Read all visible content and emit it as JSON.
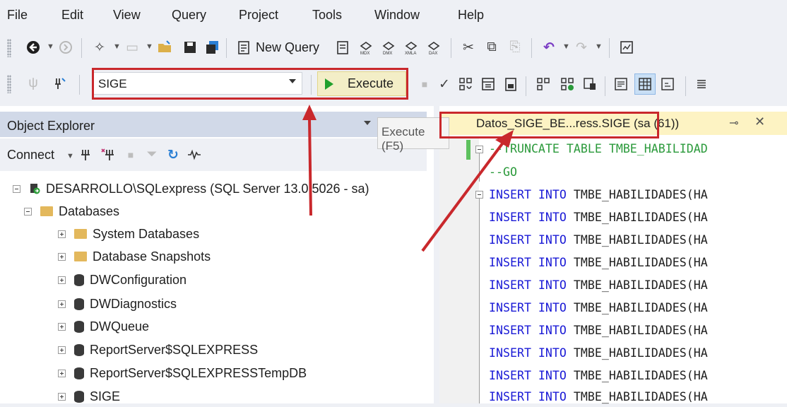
{
  "menu": [
    "File",
    "Edit",
    "View",
    "Query",
    "Project",
    "Tools",
    "Window",
    "Help"
  ],
  "toolbar1": {
    "new_query_label": "New Query"
  },
  "toolbar2": {
    "database": "SIGE",
    "execute_label": "Execute"
  },
  "tooltip": {
    "text": "Execute (F5)"
  },
  "object_explorer": {
    "title": "Object Explorer",
    "connect_label": "Connect",
    "tree": [
      {
        "label": "DESARROLLO\\SQLexpress (SQL Server 13.0.5026 - sa)",
        "icon": "server-icon"
      },
      {
        "label": "Databases",
        "icon": "folder-icon"
      },
      {
        "label": "System Databases",
        "icon": "folder-icon"
      },
      {
        "label": "Database Snapshots",
        "icon": "folder-icon"
      },
      {
        "label": "DWConfiguration",
        "icon": "database-icon"
      },
      {
        "label": "DWDiagnostics",
        "icon": "database-icon"
      },
      {
        "label": "DWQueue",
        "icon": "database-icon"
      },
      {
        "label": "ReportServer$SQLEXPRESS",
        "icon": "database-icon"
      },
      {
        "label": "ReportServer$SQLEXPRESSTempDB",
        "icon": "database-icon"
      },
      {
        "label": "SIGE",
        "icon": "database-icon"
      }
    ]
  },
  "editor": {
    "tab_title": "Datos_SIGE_BE...ress.SIGE (sa (61))",
    "lines": [
      {
        "kw": "",
        "text": "--TRUNCATE TABLE TMBE_HABILIDAD",
        "type": "comment"
      },
      {
        "kw": "",
        "text": "--GO",
        "type": "comment"
      },
      {
        "kw": "INSERT INTO",
        "text": " TMBE_HABILIDADES(HA",
        "type": "code"
      },
      {
        "kw": "INSERT INTO",
        "text": " TMBE_HABILIDADES(HA",
        "type": "code"
      },
      {
        "kw": "INSERT INTO",
        "text": " TMBE_HABILIDADES(HA",
        "type": "code"
      },
      {
        "kw": "INSERT INTO",
        "text": " TMBE_HABILIDADES(HA",
        "type": "code"
      },
      {
        "kw": "INSERT INTO",
        "text": " TMBE_HABILIDADES(HA",
        "type": "code"
      },
      {
        "kw": "INSERT INTO",
        "text": " TMBE_HABILIDADES(HA",
        "type": "code"
      },
      {
        "kw": "INSERT INTO",
        "text": " TMBE_HABILIDADES(HA",
        "type": "code"
      },
      {
        "kw": "INSERT INTO",
        "text": " TMBE_HABILIDADES(HA",
        "type": "code"
      },
      {
        "kw": "INSERT INTO",
        "text": " TMBE_HABILIDADES(HA",
        "type": "code"
      },
      {
        "kw": "INSERT INTO",
        "text": " TMBE_HABILIDADES(HA",
        "type": "code"
      }
    ]
  },
  "colors": {
    "highlight_red": "#c9282c",
    "execute_bg": "#f3eec7",
    "tab_active": "#fdf3c3",
    "keyword": "#1a1ad6",
    "comment": "#2b9a3b"
  }
}
